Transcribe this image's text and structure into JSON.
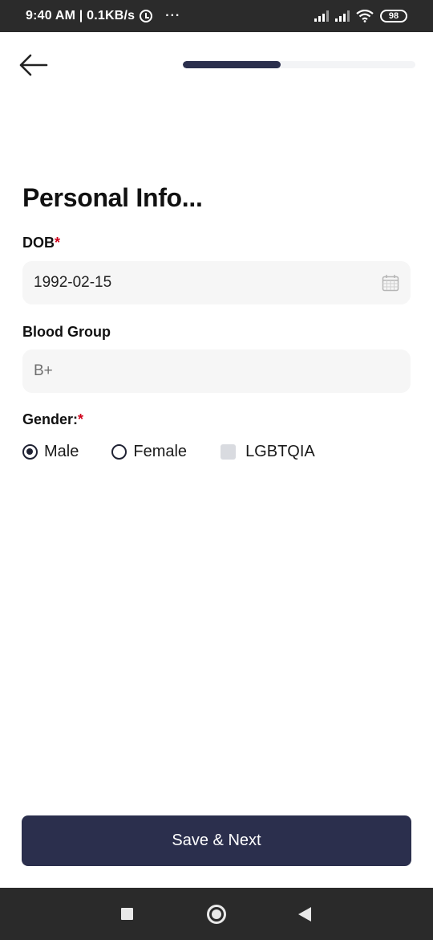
{
  "status_bar": {
    "time_speed": "9:40 AM | 0.1KB/s",
    "more_dots": "···",
    "battery": "98"
  },
  "header": {
    "back_icon": "arrow-left-icon",
    "progress_percent": 42
  },
  "form": {
    "title": "Personal Info...",
    "dob": {
      "label": "DOB",
      "required_mark": "*",
      "value": "1992-02-15",
      "icon": "calendar-icon"
    },
    "blood_group": {
      "label": "Blood Group",
      "value": "B+"
    },
    "gender": {
      "label": "Gender:",
      "required_mark": "*",
      "options": [
        {
          "label": "Male",
          "selected": true
        },
        {
          "label": "Female",
          "selected": false
        },
        {
          "label": "LGBTQIA",
          "selected": false
        }
      ]
    }
  },
  "actions": {
    "save_next_label": "Save & Next"
  },
  "colors": {
    "primary": "#2b2f4d",
    "required": "#d0021b",
    "input_bg": "#f6f6f6"
  },
  "nav_bar": {
    "recent_icon": "square-icon",
    "home_icon": "circle-icon",
    "back_icon": "triangle-back-icon"
  }
}
